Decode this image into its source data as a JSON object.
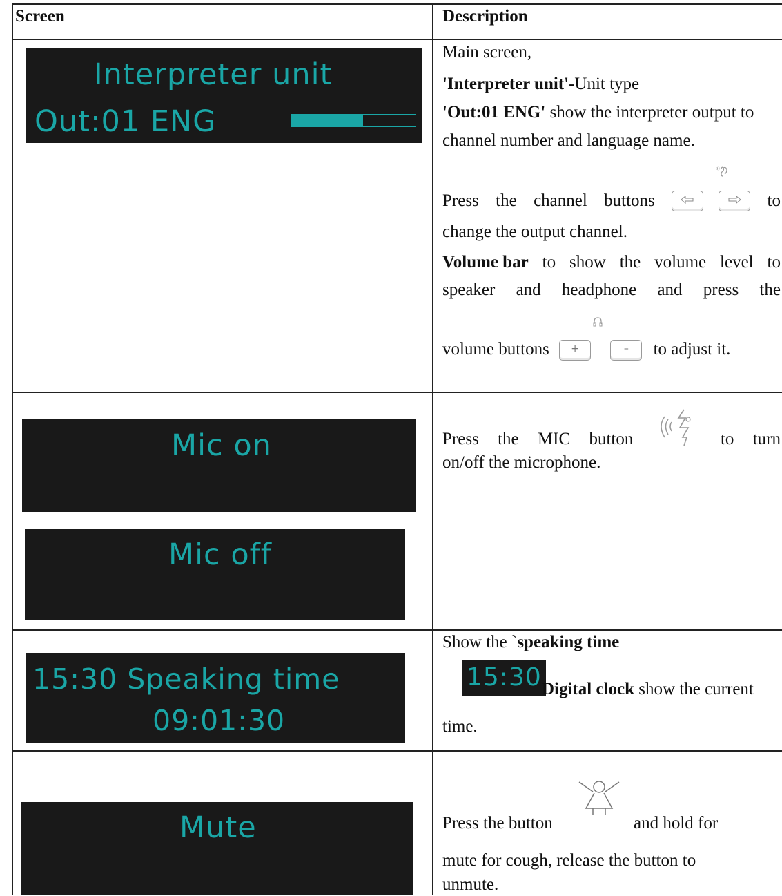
{
  "table": {
    "header": {
      "screen": "Screen",
      "description": "Description"
    }
  },
  "rows": [
    {
      "lcd": {
        "line1": "Interpreter unit",
        "line2": "Out:01 ENG",
        "volume_level": 0.58
      },
      "desc": {
        "intro": "Main screen,",
        "unit_bold": "'Interpreter unit'",
        "unit_rest": "-Unit type",
        "out_bold": "'Out:01 ENG'",
        "out_rest": " show the interpreter output to",
        "out_cont": "channel number and language name.",
        "ch_words": [
          "Press",
          "the",
          "channel",
          "buttons"
        ],
        "ch_to": "to",
        "ch_cont": "change the output channel.",
        "vol_bold": "Volume bar",
        "vol_rest_words": [
          "to",
          "show",
          "the",
          "volume",
          "level",
          "to"
        ],
        "vol_words2": [
          "speaker",
          "and",
          "headphone",
          "and",
          "press",
          "the"
        ],
        "vol_pre": "volume buttons",
        "vol_post": "to adjust it."
      }
    },
    {
      "lcd_on": "Mic on",
      "lcd_off": "Mic off",
      "desc": {
        "words": [
          "Press",
          "the",
          "MIC",
          "button"
        ],
        "tail_words": [
          "to",
          "turn"
        ],
        "cont": "on/off the microphone."
      }
    },
    {
      "lcd": {
        "line1": "15:30 Speaking time",
        "line2": "09:01:30"
      },
      "desc": {
        "show": "Show the `",
        "show_bold": "speaking time",
        "clock": "15:30",
        "clock_bold": "Digital clock",
        "clock_rest": " show the current",
        "cont": "time."
      }
    },
    {
      "lcd": "Mute",
      "desc": {
        "pre": "Press the button",
        "post": "and hold for",
        "cont1": "mute for cough, release the button to",
        "cont2": "unmute."
      }
    }
  ]
}
